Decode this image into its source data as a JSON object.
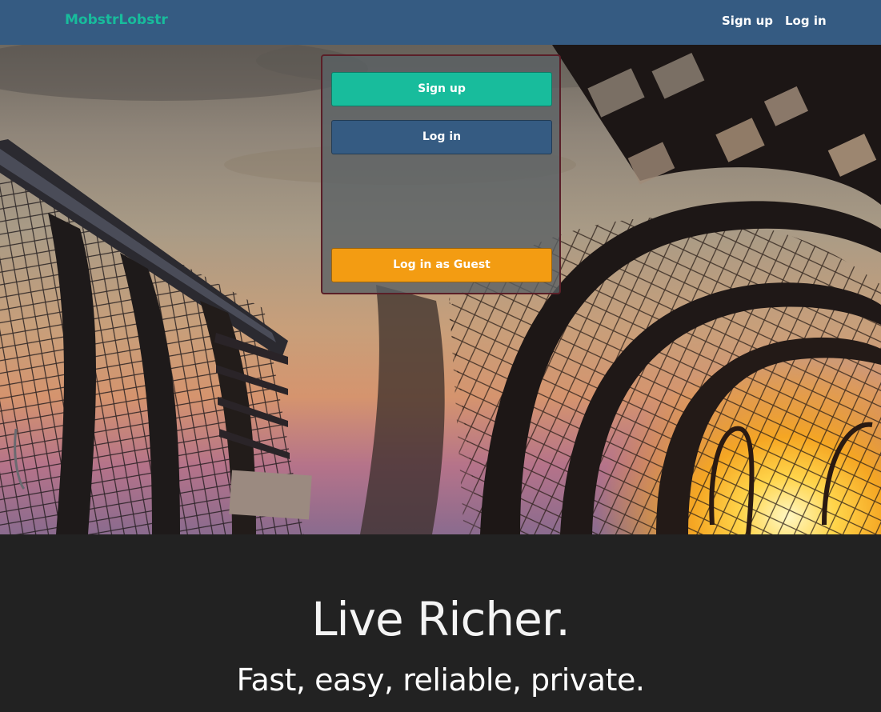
{
  "navbar": {
    "brand": "MobstrLobstr",
    "links": [
      {
        "label": "Sign up"
      },
      {
        "label": "Log in"
      }
    ]
  },
  "auth_panel": {
    "signup_label": "Sign up",
    "login_label": "Log in",
    "guest_label": "Log in as Guest"
  },
  "footer": {
    "headline": "Live Richer.",
    "tagline": "Fast, easy, reliable, private."
  },
  "colors": {
    "navbar_bg": "#355b82",
    "brand": "#18bc9c",
    "signup_button": "#18bc9c",
    "login_button": "#355b82",
    "guest_button": "#f39c12",
    "footer_bg": "#222222"
  },
  "hero": {
    "image": "lobster-traps-sunset-photo"
  }
}
